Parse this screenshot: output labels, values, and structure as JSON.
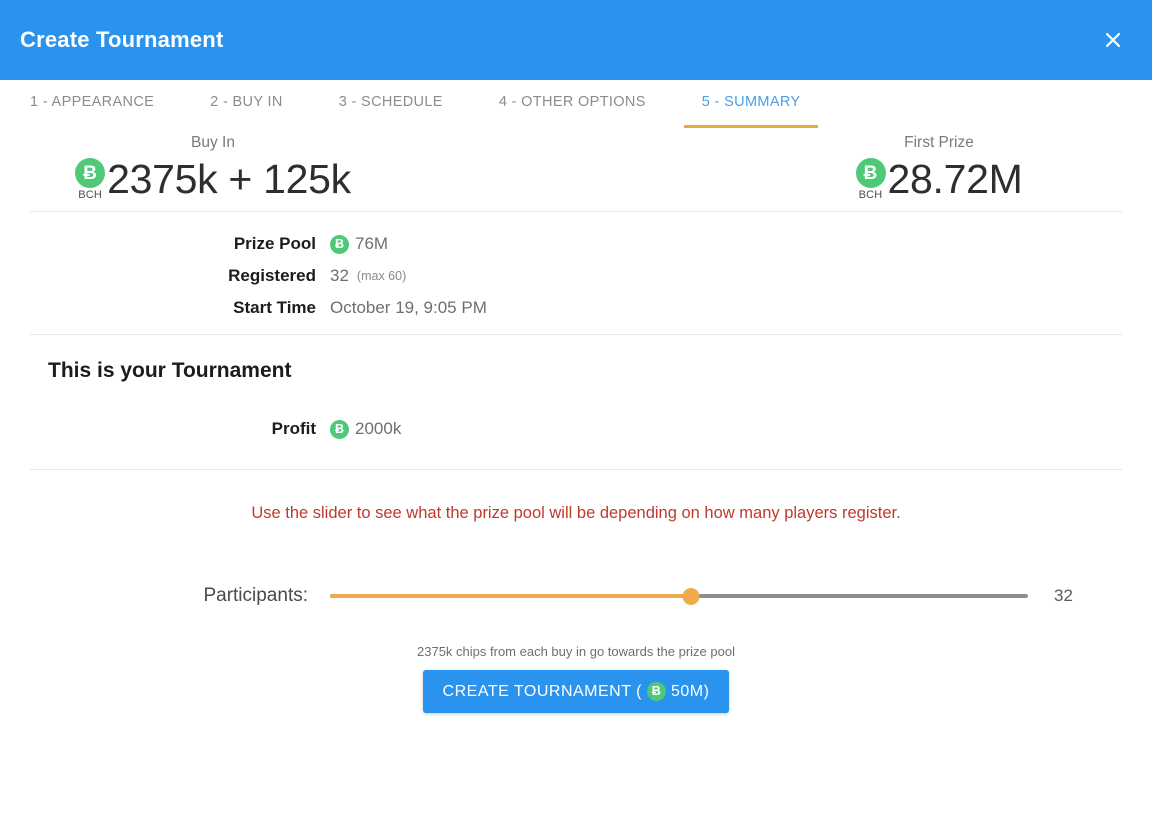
{
  "header": {
    "title": "Create Tournament",
    "close_label": "×",
    "background_color": "#2a93ee"
  },
  "tabs": [
    {
      "label": "1 - APPEARANCE",
      "active": false
    },
    {
      "label": "2 - BUY IN",
      "active": false
    },
    {
      "label": "3 - SCHEDULE",
      "active": false
    },
    {
      "label": "4 - OTHER OPTIONS",
      "active": false
    },
    {
      "label": "5 - SUMMARY",
      "active": true
    }
  ],
  "active_tab_color": "#4a9fe8",
  "active_tab_underline_color": "#eaa83f",
  "currency": {
    "ticker": "BCH",
    "symbol": "Ƀ",
    "color": "#4fc878"
  },
  "hero": {
    "buy_in": {
      "label": "Buy In",
      "amount": "2375k + 125k"
    },
    "first_prize": {
      "label": "First Prize",
      "amount": "28.72M"
    }
  },
  "details": [
    {
      "label": "Prize Pool",
      "value": "76M",
      "has_coin": true,
      "sub": ""
    },
    {
      "label": "Registered",
      "value": "32",
      "has_coin": false,
      "sub": "(max 60)"
    },
    {
      "label": "Start Time",
      "value": "October 19, 9:05 PM",
      "has_coin": false,
      "sub": ""
    }
  ],
  "your_tournament": {
    "title": "This is your Tournament",
    "profit_label": "Profit",
    "profit_value": "2000k"
  },
  "notice": {
    "text": "Use the slider to see what the prize pool will be depending on how many players register.",
    "color": "#c0392b"
  },
  "slider": {
    "label": "Participants:",
    "value": "32",
    "min": 2,
    "max": 60,
    "percent": 51.7,
    "fill_color": "#efab4b",
    "track_color": "#8e8e8e"
  },
  "footer": {
    "footnote": "2375k chips from each buy in go towards the prize pool",
    "cta_prefix": "CREATE TOURNAMENT (",
    "cta_amount": "50M)",
    "cta_color": "#2a93ee"
  }
}
